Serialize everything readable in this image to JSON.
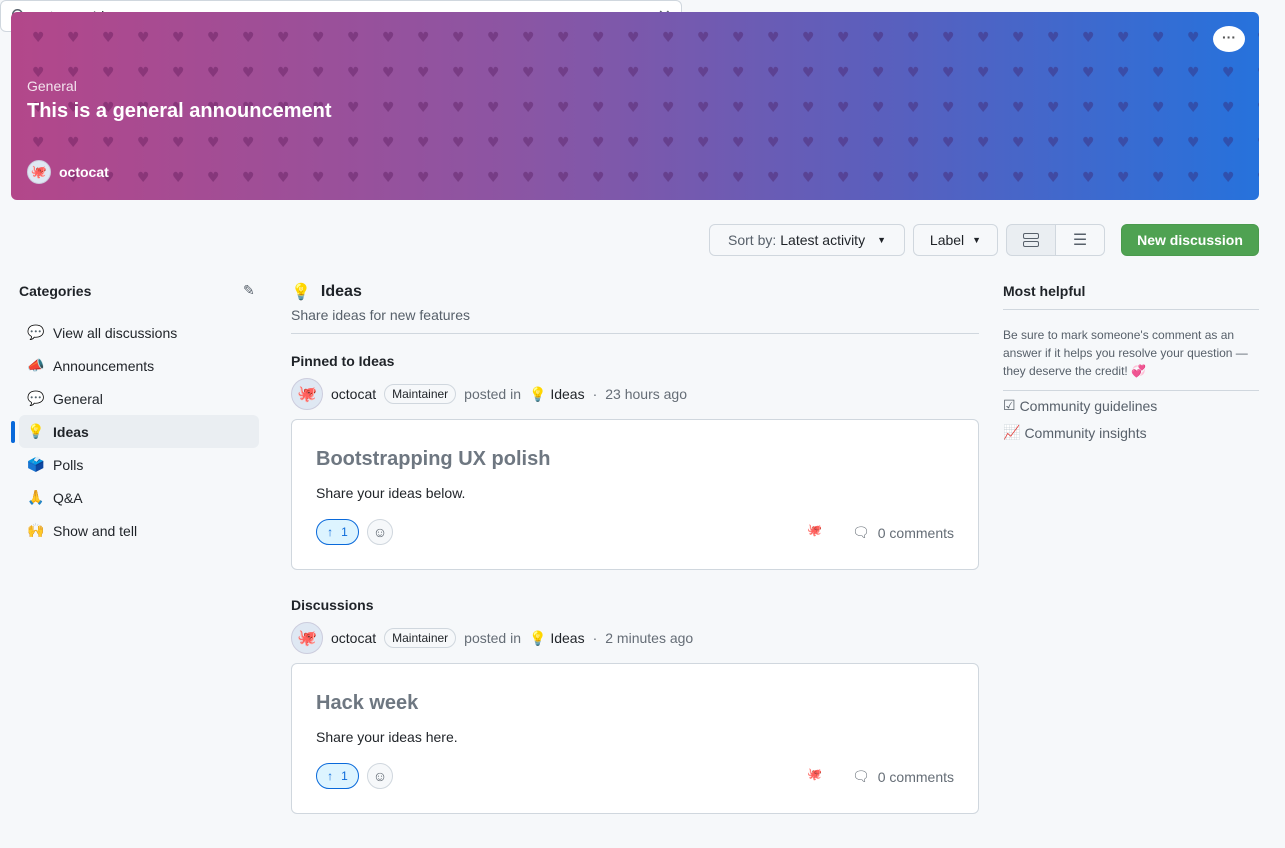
{
  "banner": {
    "category": "General",
    "title": "This is a general announcement",
    "user": "octocat",
    "colors": {
      "start": "#b3478a",
      "end": "#2672dc"
    }
  },
  "toolbar": {
    "search_value": "category:Ideas",
    "sort_prefix": "Sort by:",
    "sort_value": "Latest activity",
    "label": "Label",
    "new_discussion": "New discussion",
    "new_color": "#4fa252"
  },
  "sidebar": {
    "title": "Categories",
    "items": [
      {
        "icon": "💬",
        "label": "View all discussions"
      },
      {
        "icon": "📣",
        "label": "Announcements"
      },
      {
        "icon": "💬",
        "label": "General"
      },
      {
        "icon": "💡",
        "label": "Ideas",
        "active": true
      },
      {
        "icon": "🗳️",
        "label": "Polls"
      },
      {
        "icon": "🙏",
        "label": "Q&A"
      },
      {
        "icon": "🙌",
        "label": "Show and tell"
      }
    ]
  },
  "main": {
    "title": "Ideas",
    "icon": "💡",
    "description": "Share ideas for new features",
    "pinned_title": "Pinned to Ideas",
    "discussions_title": "Discussions",
    "posts": [
      {
        "author": "octocat",
        "badge": "Maintainer",
        "posted_in": "posted in",
        "category": "Ideas",
        "time": "23 hours ago",
        "title": "Bootstrapping UX polish",
        "body": "Share your ideas below.",
        "votes": "1",
        "comments": "0 comments"
      },
      {
        "author": "octocat",
        "badge": "Maintainer",
        "posted_in": "posted in",
        "category": "Ideas",
        "time": "2 minutes ago",
        "title": "Hack week",
        "body": "Share your ideas here.",
        "votes": "1",
        "comments": "0 comments"
      }
    ]
  },
  "right": {
    "title": "Most helpful",
    "text": "Be sure to mark someone's comment as an answer if it helps you resolve your question — they deserve the credit! 💞",
    "links": [
      "Community guidelines",
      "Community insights"
    ]
  }
}
